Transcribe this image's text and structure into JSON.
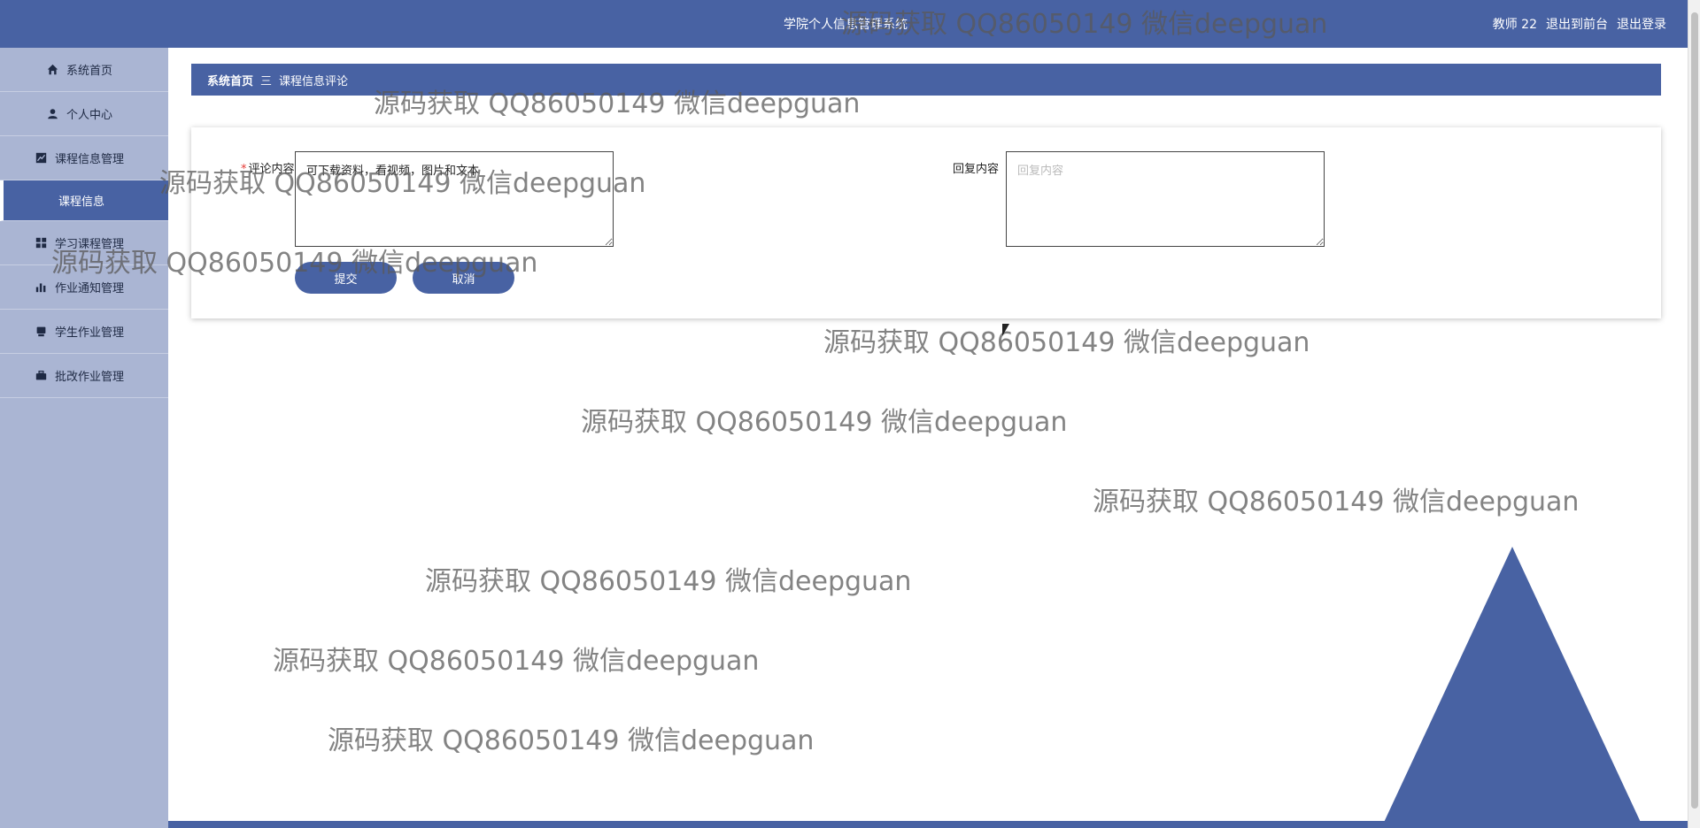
{
  "header": {
    "system_title": "学院个人信息管理系统",
    "user": "教师 22",
    "to_front": "退出到前台",
    "logout": "退出登录"
  },
  "sidebar": {
    "items": [
      {
        "label": "系统首页",
        "icon": "home-icon"
      },
      {
        "label": "个人中心",
        "icon": "user-icon"
      },
      {
        "label": "课程信息管理",
        "icon": "chart-icon"
      },
      {
        "label": "课程信息",
        "icon": ""
      },
      {
        "label": "学习课程管理",
        "icon": "grid-icon"
      },
      {
        "label": "作业通知管理",
        "icon": "bar-chart-icon"
      },
      {
        "label": "学生作业管理",
        "icon": "tray-icon"
      },
      {
        "label": "批改作业管理",
        "icon": "briefcase-icon"
      }
    ]
  },
  "breadcrumb": {
    "home": "系统首页",
    "separator": "三",
    "current": "课程信息评论"
  },
  "form": {
    "comment_label": "评论内容",
    "comment_value": "可下载资料，看视频，图片和文本",
    "reply_label": "回复内容",
    "reply_placeholder": "回复内容",
    "submit": "提交",
    "cancel": "取消"
  },
  "watermark": "源码获取 QQ86050149 微信deepguan",
  "colors": {
    "primary": "#4862a3",
    "sidebar": "#aab5d3"
  }
}
